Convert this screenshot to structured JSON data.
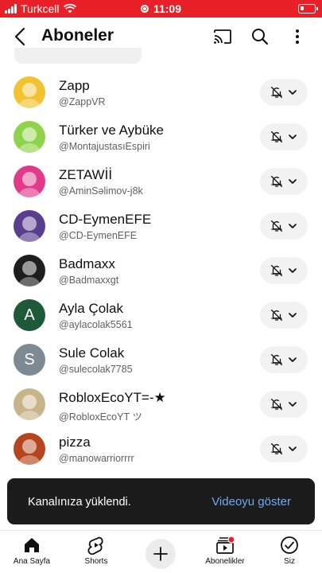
{
  "status_bar": {
    "carrier": "Turkcell",
    "time": "11:09"
  },
  "header": {
    "title": "Aboneler"
  },
  "subscriptions": [
    {
      "name": "Zapp",
      "handle": "@ZappVR",
      "avatar_color": "#f2c230",
      "avatar_icon": "gorilla-logo"
    },
    {
      "name": "Türker ve Aybüke",
      "handle": "@MontajustasıEspiri",
      "avatar_color": "#8fd34a",
      "avatar_icon": "brawl-stars-logo"
    },
    {
      "name": "ZETAWİİ",
      "handle": "@AminSəlimov-j8k",
      "avatar_color": "#e23a8a",
      "avatar_icon": "game-character"
    },
    {
      "name": "CD-EymenEFE",
      "handle": "@CD-EymenEFE",
      "avatar_color": "#5a3e8e",
      "avatar_icon": "game-character"
    },
    {
      "name": "Badmaxx",
      "handle": "@Badmaxxgt",
      "avatar_color": "#1e1e1e",
      "avatar_icon": "game-character"
    },
    {
      "name": "Ayla Çolak",
      "handle": "@aylacolak5561",
      "avatar_color": "#1e5a3a",
      "avatar_letter": "A"
    },
    {
      "name": "Sule Colak",
      "handle": "@sulecolak7785",
      "avatar_color": "#7d8a94",
      "avatar_letter": "S"
    },
    {
      "name": "RobloxEcoYT=-★",
      "handle": "@RobloxEcoYT ツ",
      "avatar_color": "#c9b48a",
      "avatar_icon": "photo"
    },
    {
      "name": "pizza",
      "handle": "@manowarriorrrr",
      "avatar_color": "#b5451e",
      "avatar_icon": "photo"
    }
  ],
  "snackbar": {
    "message": "Kanalınıza yüklendi.",
    "action": "Videoyu göster"
  },
  "bottom_nav": {
    "home": "Ana Sayfa",
    "shorts": "Shorts",
    "subscriptions": "Abonelikler",
    "you": "Siz"
  }
}
